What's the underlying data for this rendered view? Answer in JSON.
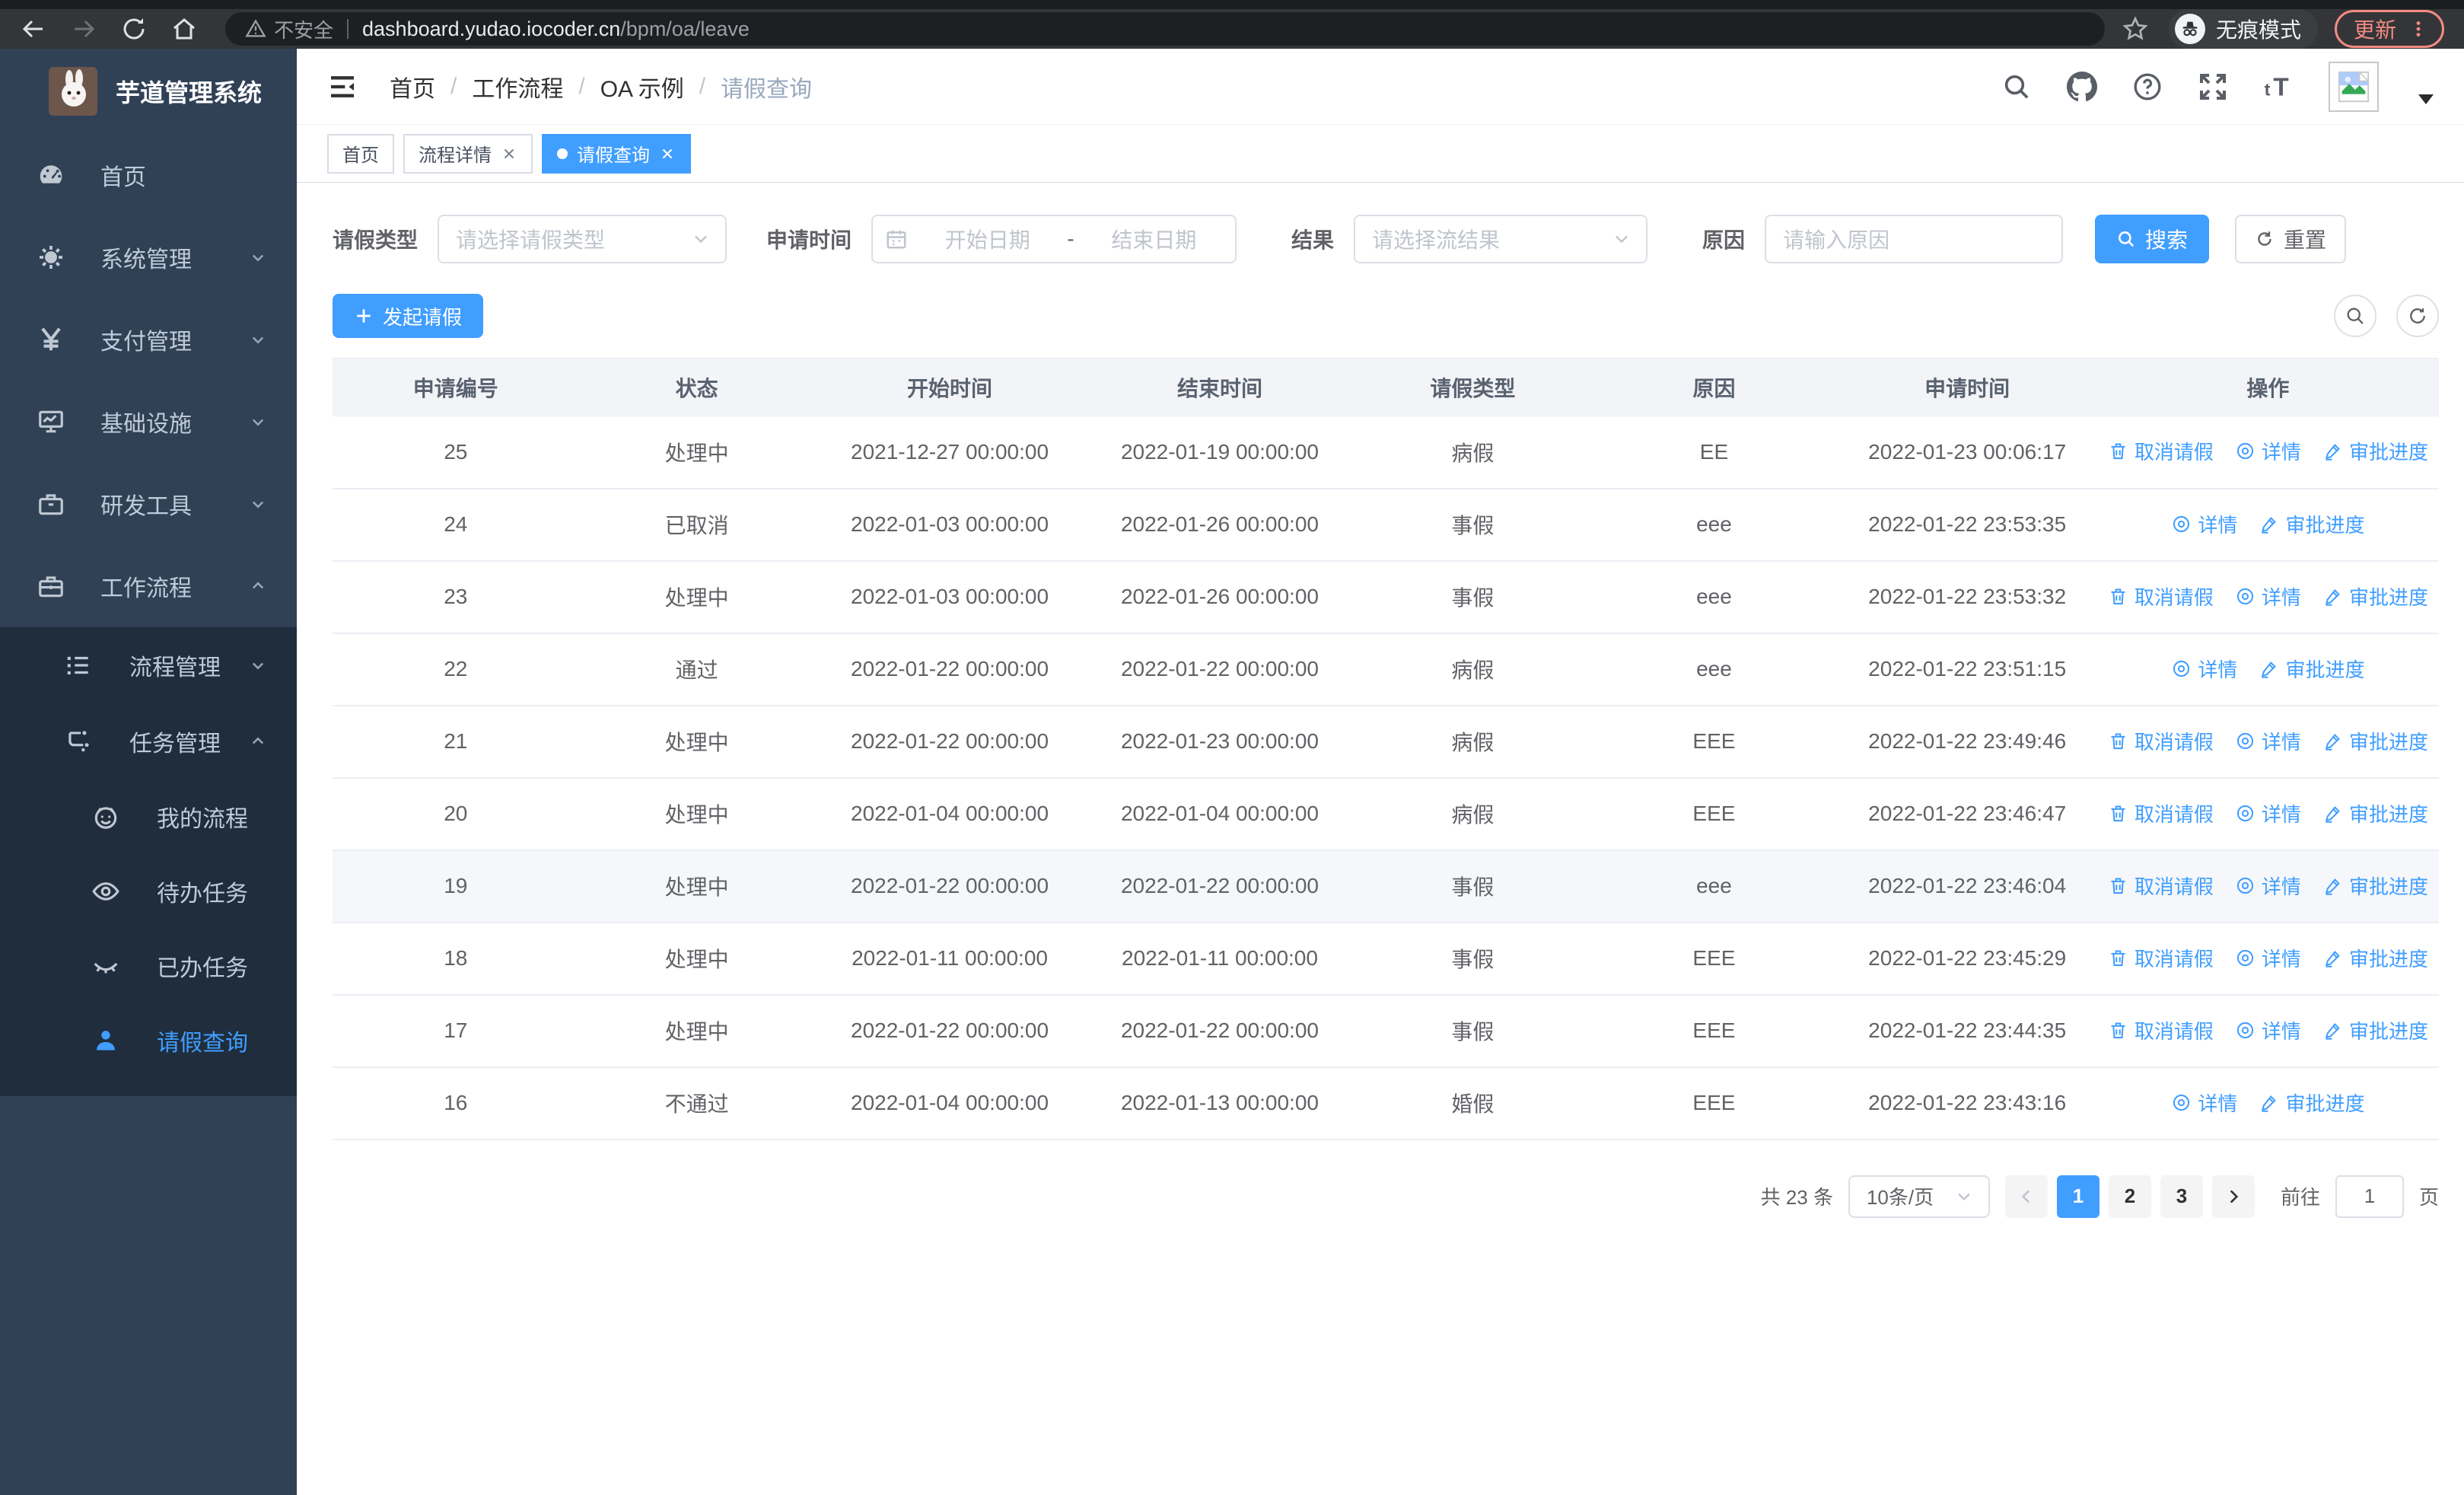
{
  "browser": {
    "security_label": "不安全",
    "url_host": "dashboard.yudao.iocoder.cn",
    "url_path": "/bpm/oa/leave",
    "incognito_label": "无痕模式",
    "update_label": "更新"
  },
  "sidebar": {
    "title": "芋道管理系统",
    "items": [
      {
        "label": "首页"
      },
      {
        "label": "系统管理"
      },
      {
        "label": "支付管理"
      },
      {
        "label": "基础设施"
      },
      {
        "label": "研发工具"
      },
      {
        "label": "工作流程"
      },
      {
        "label": "流程管理"
      },
      {
        "label": "任务管理"
      },
      {
        "label": "我的流程"
      },
      {
        "label": "待办任务"
      },
      {
        "label": "已办任务"
      },
      {
        "label": "请假查询"
      }
    ]
  },
  "header": {
    "breadcrumb": [
      "首页",
      "工作流程",
      "OA 示例",
      "请假查询"
    ],
    "breadcrumb_separator": "/"
  },
  "tabs": [
    {
      "label": "首页"
    },
    {
      "label": "流程详情"
    },
    {
      "label": "请假查询"
    }
  ],
  "filters": {
    "leave_type_label": "请假类型",
    "leave_type_placeholder": "请选择请假类型",
    "apply_time_label": "申请时间",
    "start_date_placeholder": "开始日期",
    "range_separator": "-",
    "end_date_placeholder": "结束日期",
    "result_label": "结果",
    "result_placeholder": "请选择流结果",
    "reason_label": "原因",
    "reason_placeholder": "请输入原因",
    "search_label": "搜索",
    "reset_label": "重置"
  },
  "toolbar": {
    "create_label": "发起请假"
  },
  "table": {
    "columns": [
      "申请编号",
      "状态",
      "开始时间",
      "结束时间",
      "请假类型",
      "原因",
      "申请时间",
      "操作"
    ],
    "actions": {
      "cancel": "取消请假",
      "detail": "详情",
      "progress": "审批进度"
    },
    "rows": [
      {
        "id": "25",
        "status": "处理中",
        "start": "2021-12-27 00:00:00",
        "end": "2022-01-19 00:00:00",
        "type": "病假",
        "reason": "EE",
        "applied": "2022-01-23 00:06:17",
        "can_cancel": true,
        "highlight": false
      },
      {
        "id": "24",
        "status": "已取消",
        "start": "2022-01-03 00:00:00",
        "end": "2022-01-26 00:00:00",
        "type": "事假",
        "reason": "eee",
        "applied": "2022-01-22 23:53:35",
        "can_cancel": false,
        "highlight": false
      },
      {
        "id": "23",
        "status": "处理中",
        "start": "2022-01-03 00:00:00",
        "end": "2022-01-26 00:00:00",
        "type": "事假",
        "reason": "eee",
        "applied": "2022-01-22 23:53:32",
        "can_cancel": true,
        "highlight": false
      },
      {
        "id": "22",
        "status": "通过",
        "start": "2022-01-22 00:00:00",
        "end": "2022-01-22 00:00:00",
        "type": "病假",
        "reason": "eee",
        "applied": "2022-01-22 23:51:15",
        "can_cancel": false,
        "highlight": false
      },
      {
        "id": "21",
        "status": "处理中",
        "start": "2022-01-22 00:00:00",
        "end": "2022-01-23 00:00:00",
        "type": "病假",
        "reason": "EEE",
        "applied": "2022-01-22 23:49:46",
        "can_cancel": true,
        "highlight": false
      },
      {
        "id": "20",
        "status": "处理中",
        "start": "2022-01-04 00:00:00",
        "end": "2022-01-04 00:00:00",
        "type": "病假",
        "reason": "EEE",
        "applied": "2022-01-22 23:46:47",
        "can_cancel": true,
        "highlight": false
      },
      {
        "id": "19",
        "status": "处理中",
        "start": "2022-01-22 00:00:00",
        "end": "2022-01-22 00:00:00",
        "type": "事假",
        "reason": "eee",
        "applied": "2022-01-22 23:46:04",
        "can_cancel": true,
        "highlight": true
      },
      {
        "id": "18",
        "status": "处理中",
        "start": "2022-01-11 00:00:00",
        "end": "2022-01-11 00:00:00",
        "type": "事假",
        "reason": "EEE",
        "applied": "2022-01-22 23:45:29",
        "can_cancel": true,
        "highlight": false
      },
      {
        "id": "17",
        "status": "处理中",
        "start": "2022-01-22 00:00:00",
        "end": "2022-01-22 00:00:00",
        "type": "事假",
        "reason": "EEE",
        "applied": "2022-01-22 23:44:35",
        "can_cancel": true,
        "highlight": false
      },
      {
        "id": "16",
        "status": "不通过",
        "start": "2022-01-04 00:00:00",
        "end": "2022-01-13 00:00:00",
        "type": "婚假",
        "reason": "EEE",
        "applied": "2022-01-22 23:43:16",
        "can_cancel": false,
        "highlight": false
      }
    ]
  },
  "pagination": {
    "total": "共 23 条",
    "page_size": "10条/页",
    "pages": [
      "1",
      "2",
      "3"
    ],
    "active_page": "1",
    "goto_label": "前往",
    "goto_value": "1",
    "page_unit": "页"
  },
  "colors": {
    "accent": "#409eff",
    "sidebar": "#304156",
    "submenu": "#1f2d3d",
    "update": "#f28b82"
  }
}
